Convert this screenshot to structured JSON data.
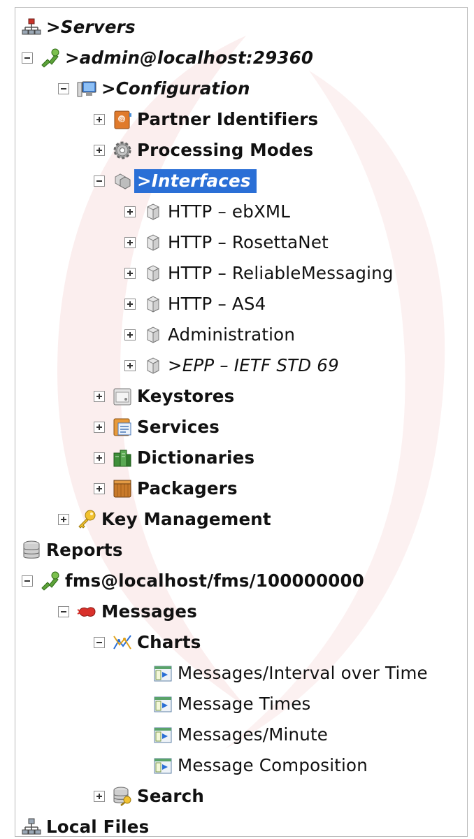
{
  "tree": {
    "servers": ">Servers",
    "admin": ">admin@localhost:29360",
    "configuration": ">Configuration",
    "partner_identifiers": "Partner Identifiers",
    "processing_modes": "Processing Modes",
    "interfaces": ">Interfaces",
    "http_ebxml": "HTTP – ebXML",
    "http_rosettanet": "HTTP – RosettaNet",
    "http_reliable": "HTTP – ReliableMessaging",
    "http_as4": "HTTP – AS4",
    "administration": "Administration",
    "epp": ">EPP – IETF STD 69",
    "keystores": "Keystores",
    "services": "Services",
    "dictionaries": "Dictionaries",
    "packagers": "Packagers",
    "key_management": "Key Management",
    "reports": "Reports",
    "fms": "fms@localhost/fms/100000000",
    "messages": "Messages",
    "charts": "Charts",
    "chart_interval": "Messages/Interval over Time",
    "chart_times": "Message Times",
    "chart_minute": "Messages/Minute",
    "chart_composition": "Message Composition",
    "search": "Search",
    "local_files": "Local Files"
  },
  "colors": {
    "selection": "#2a6fd6",
    "watermark": "#fbeeee",
    "server_green": "#5da33a"
  }
}
